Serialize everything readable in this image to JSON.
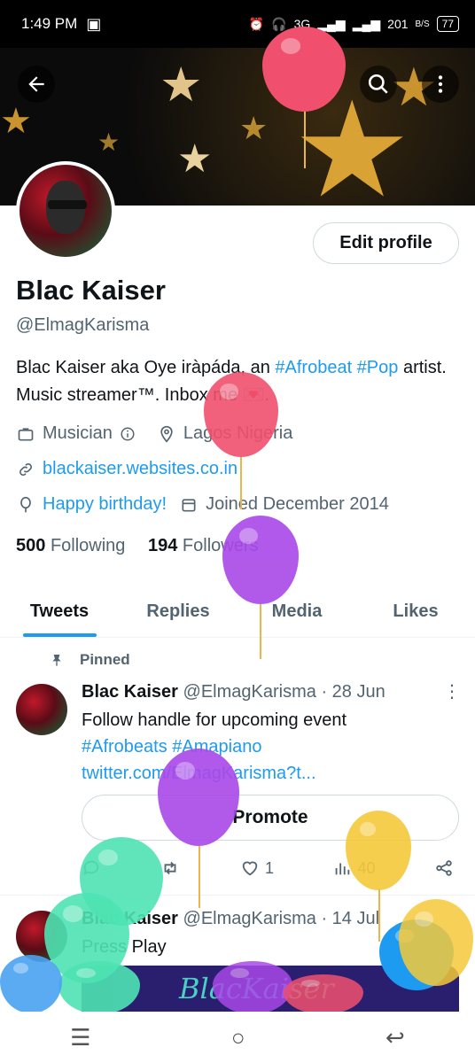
{
  "status_bar": {
    "time": "1:49 PM",
    "network": "3G",
    "speed": "201",
    "speed_unit": "B/S",
    "battery": "77"
  },
  "header": {
    "back_icon": "arrow-left-icon",
    "search_icon": "search-icon",
    "more_icon": "more-vertical-icon"
  },
  "profile": {
    "edit_label": "Edit profile",
    "name": "Blac Kaiser",
    "handle": "@ElmagKarisma",
    "bio_prefix": "Blac Kaiser aka Oye iràpáda, an ",
    "bio_tag1": "#Afrobeat",
    "bio_tag2": "#Pop",
    "bio_suffix": "artist. Music streamer™. Inbox me 💌.",
    "category": "Musician",
    "location": "Lagos Nigeria",
    "website": "blackaiser.websites.co.in",
    "birthday": "Happy birthday!",
    "joined": "Joined December 2014",
    "following_count": "500",
    "following_label": "Following",
    "followers_count": "194",
    "followers_label": "Followers"
  },
  "tabs": [
    {
      "label": "Tweets"
    },
    {
      "label": "Replies"
    },
    {
      "label": "Media"
    },
    {
      "label": "Likes"
    }
  ],
  "tweets": [
    {
      "pinned_label": "Pinned",
      "name": "Blac Kaiser",
      "handle": "@ElmagKarisma",
      "date": "· 28 Jun",
      "line1": "Follow handle for upcoming event",
      "line2": "#Afrobeats #Amapiano",
      "line3": "twitter.com/ElmagKarisma?t...",
      "promote_label": "Promote",
      "likes": "1",
      "views": "40"
    },
    {
      "name": "Blac Kaiser",
      "handle": "@ElmagKarisma",
      "date": "· 14 Jul",
      "text": "Press Play",
      "media_text": "BlacKaiser"
    }
  ],
  "colors": {
    "accent": "#1d9bf0",
    "balloon_red": "#f0506e",
    "balloon_purple": "#a948e8",
    "balloon_yellow": "#f6c93a",
    "balloon_green": "#4ee3b2",
    "balloon_blue": "#4aa3f2"
  }
}
